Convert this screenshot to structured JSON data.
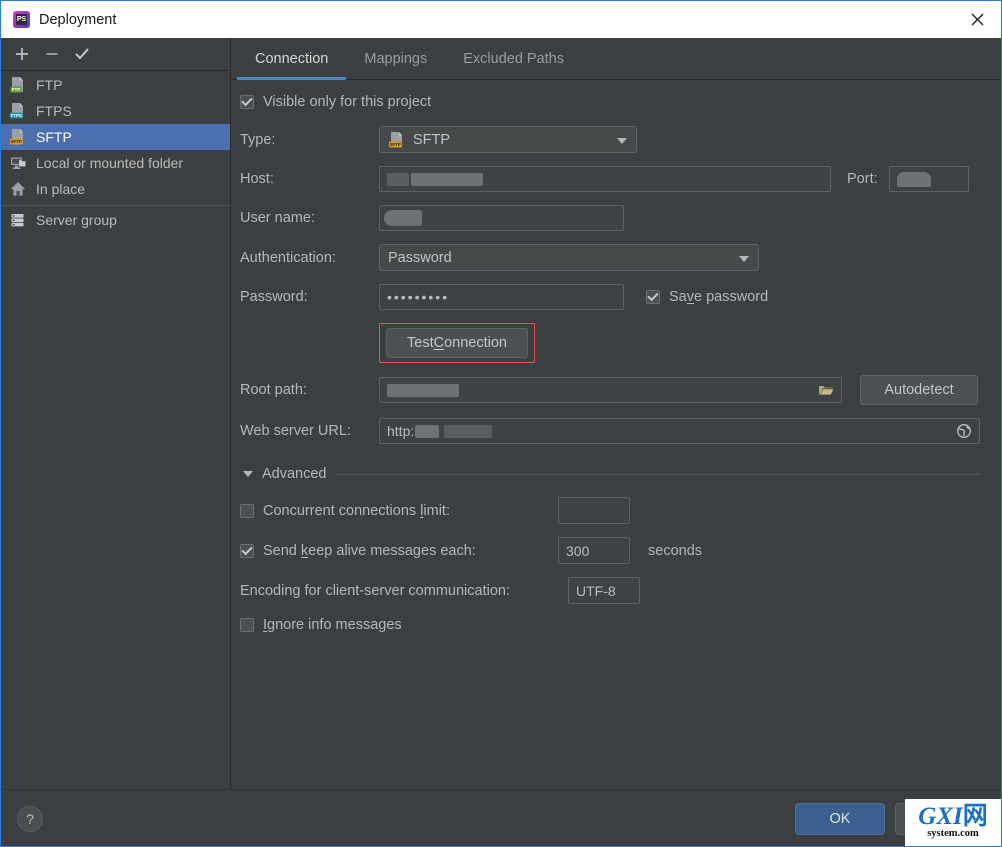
{
  "window": {
    "title": "Deployment",
    "app_icon": "phpstorm-icon",
    "close_icon": "close-icon"
  },
  "toolbar": {
    "add_label": "+",
    "remove_label": "−",
    "check_label": "✓"
  },
  "sidebar": {
    "items": [
      {
        "label": "FTP",
        "icon": "ftp-icon",
        "badge": "FTP",
        "badge_color": "#6a9b3a",
        "selected": false,
        "separator_above": false
      },
      {
        "label": "FTPS",
        "icon": "ftps-icon",
        "badge": "FTPS",
        "badge_color": "#2b8fa8",
        "selected": false,
        "separator_above": false
      },
      {
        "label": "SFTP",
        "icon": "sftp-icon",
        "badge": "SFTP",
        "badge_color": "#d19a24",
        "selected": true,
        "separator_above": false
      },
      {
        "label": "Local or mounted folder",
        "icon": "monitor-folder-icon",
        "badge": "",
        "badge_color": "",
        "selected": false,
        "separator_above": false
      },
      {
        "label": "In place",
        "icon": "home-icon",
        "badge": "",
        "badge_color": "",
        "selected": false,
        "separator_above": false
      },
      {
        "label": "Server group",
        "icon": "server-group-icon",
        "badge": "",
        "badge_color": "",
        "selected": false,
        "separator_above": true
      }
    ]
  },
  "tabs": [
    {
      "label": "Connection",
      "active": true
    },
    {
      "label": "Mappings",
      "active": false
    },
    {
      "label": "Excluded Paths",
      "active": false
    }
  ],
  "form": {
    "visible_only": {
      "label": "Visible only for this project",
      "checked": true
    },
    "type": {
      "label": "Type:",
      "value": "SFTP",
      "icon": "sftp-icon",
      "badge": "SFTP"
    },
    "host": {
      "label": "Host:",
      "value": "",
      "redacted": true
    },
    "port": {
      "label": "Port:",
      "value": "",
      "redacted": true
    },
    "user_name": {
      "label": "User name:",
      "value": "",
      "redacted": true
    },
    "authentication": {
      "label": "Authentication:",
      "value": "Password"
    },
    "password": {
      "label": "Password:",
      "value": "•••••••••"
    },
    "save_password": {
      "label_pre": "Sa",
      "label_mnemonic": "v",
      "label_post": "e password",
      "checked": true
    },
    "test_connection": {
      "label_pre": "Test ",
      "label_mnemonic": "C",
      "label_post": "onnection",
      "highlighted": true,
      "highlight_color": "#e8554e"
    },
    "root_path": {
      "label": "Root path:",
      "value": "",
      "redacted": true,
      "browse_icon": "folder-icon"
    },
    "autodetect": {
      "label": "Autodetect"
    },
    "web_server_url": {
      "label": "Web server URL:",
      "value": "http:",
      "redacted": true,
      "open_icon": "globe-icon"
    }
  },
  "advanced": {
    "title": "Advanced",
    "expanded": true,
    "concurrent": {
      "label_pre": "Concurrent connections ",
      "label_mnemonic": "l",
      "label_post": "imit:",
      "checked": false,
      "value": ""
    },
    "keepalive": {
      "label_pre": "Send ",
      "label_mnemonic": "k",
      "label_post": "eep alive messages each:",
      "checked": true,
      "value": "300",
      "unit": "seconds"
    },
    "encoding": {
      "label": "Encoding for client-server communication:",
      "value": "UTF-8"
    },
    "ignore_info": {
      "label_pre": "",
      "label_mnemonic": "I",
      "label_post": "gnore info messages",
      "checked": false
    }
  },
  "footer": {
    "help_label": "?",
    "ok_label": "OK",
    "cancel_label": ""
  },
  "watermark": {
    "line1_g": "G",
    "line1_xi": "XI",
    "line1_cjk": "网",
    "line2": "system.com"
  },
  "colors": {
    "accent": "#4b6eaf",
    "tab_underline": "#4a88c7",
    "highlight": "#e8554e",
    "background": "#3c3f41",
    "titlebar": "#ffffff"
  }
}
